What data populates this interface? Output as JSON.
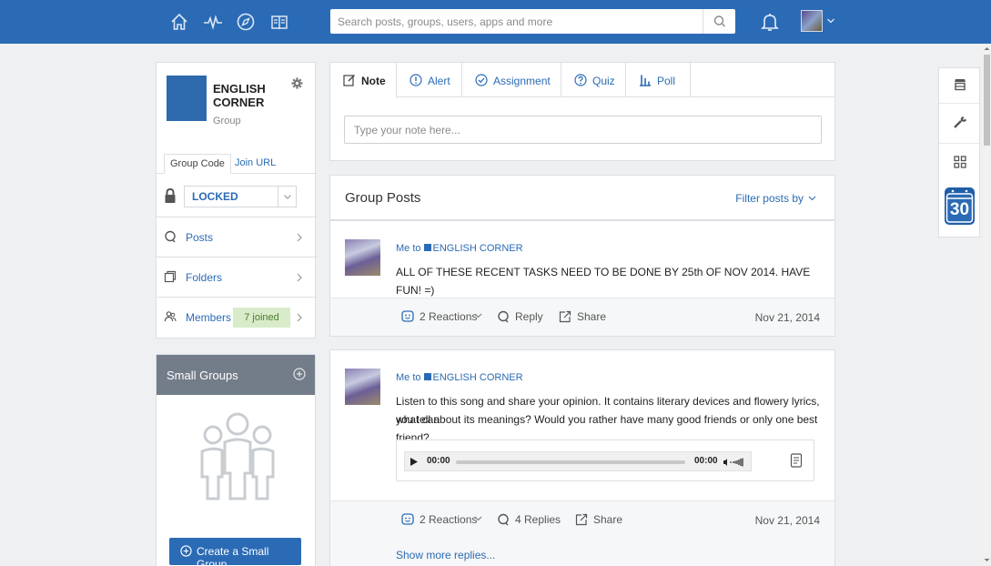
{
  "colors": {
    "brand": "#2b6bb5",
    "joined_bg": "#d8ecc9",
    "small_groups_header": "#737d89"
  },
  "topbar": {
    "nav_icons": [
      "home-icon",
      "activity-icon",
      "discover-icon",
      "library-icon"
    ],
    "search_placeholder": "Search posts, groups, users, apps and more",
    "search_icon": "search-icon",
    "notifications_icon": "bell-icon"
  },
  "group": {
    "name": "ENGLISH CORNER",
    "type": "Group",
    "tabs": {
      "code": "Group Code",
      "url": "Join URL"
    },
    "lock_status": "LOCKED",
    "menu": {
      "posts": "Posts",
      "folders": "Folders",
      "members": "Members",
      "members_joined": "7 joined"
    }
  },
  "small_groups": {
    "title": "Small Groups",
    "create_button": "Create a Small Group"
  },
  "composer": {
    "tabs": [
      "Note",
      "Alert",
      "Assignment",
      "Quiz",
      "Poll"
    ],
    "active_tab": "Note",
    "placeholder": "Type your note here..."
  },
  "posts_header": {
    "title": "Group Posts",
    "filter": "Filter posts by"
  },
  "posts": [
    {
      "author": "Me",
      "to_word": "to",
      "group": "ENGLISH CORNER",
      "text": "ALL OF THESE RECENT TASKS NEED TO BE DONE BY 25th OF NOV 2014. HAVE FUN! =)",
      "reactions": "2 Reactions",
      "reply": "Reply",
      "share": "Share",
      "date": "Nov 21, 2014"
    },
    {
      "author": "Me",
      "to_word": "to",
      "group": "ENGLISH CORNER",
      "text_line1": "Listen to this song and share your opinion. It contains literary devices and flowery lyrics, what can",
      "text_line2": "you tell about its meanings? Would you rather have many good friends or only one best friend?",
      "audio": {
        "current": "00:00",
        "duration": "00:00"
      },
      "reactions": "2 Reactions",
      "replies": "4 Replies",
      "share": "Share",
      "date": "Nov 21, 2014",
      "show_more": "Show more replies..."
    }
  ],
  "rail": {
    "calendar_day": "30"
  }
}
